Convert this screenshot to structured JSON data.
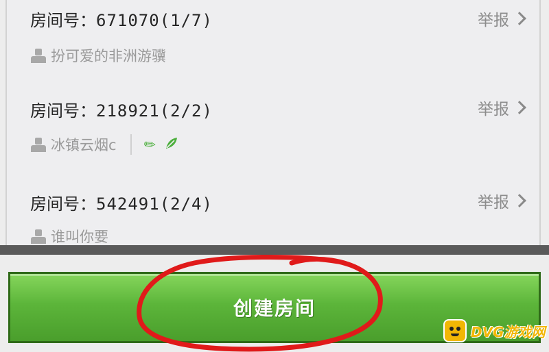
{
  "rooms": [
    {
      "title_prefix": "房间号：",
      "room_number": "671070",
      "occupancy": "(1/7)",
      "report_label": "举报",
      "owner": "扮可爱的非洲游骥",
      "badges": []
    },
    {
      "title_prefix": "房间号：",
      "room_number": "218921",
      "occupancy": "(2/2)",
      "report_label": "举报",
      "owner": "冰镇云烟c",
      "badges": [
        "pencil-icon",
        "leaf-icon"
      ]
    },
    {
      "title_prefix": "房间号：",
      "room_number": "542491",
      "occupancy": "(2/4)",
      "report_label": "举报",
      "owner": "谁叫你要",
      "badges": []
    }
  ],
  "create_button": {
    "label": "创建房间"
  },
  "watermark": {
    "text": "DVG游戏网"
  },
  "colors": {
    "button_green": "#5cb53a",
    "annotation_red": "#e01a1a",
    "badge_green": "#4caf3d",
    "watermark_yellow": "#f2b705"
  }
}
